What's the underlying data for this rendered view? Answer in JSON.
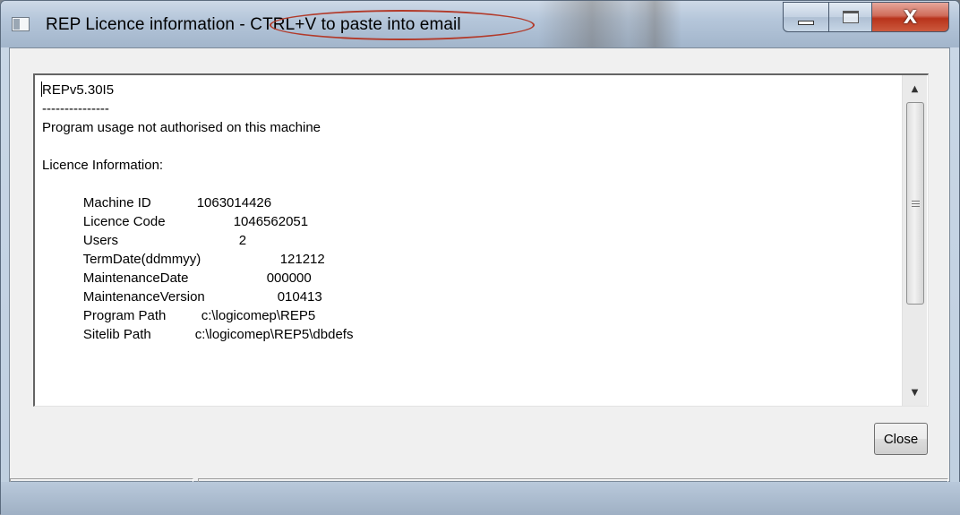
{
  "window": {
    "title": "REP Licence information - CTRL+V to paste into email"
  },
  "caption_buttons": {
    "minimize_icon": "minimize-icon",
    "maximize_icon": "maximize-icon",
    "close_glyph": "X"
  },
  "textbox": {
    "lines": [
      {
        "text": "REPv5.30I5"
      },
      {
        "text": "---------------"
      },
      {
        "text": "Program usage not authorised on this machine"
      },
      {
        "text": ""
      },
      {
        "text": "Licence Information:"
      }
    ],
    "fields": [
      {
        "label": " Machine ID",
        "value": "1063014426"
      },
      {
        "label": " Licence Code",
        "value": "1046562051"
      },
      {
        "label": " Users",
        "value": "2"
      },
      {
        "label": " TermDate(ddmmyy)",
        "value": "121212"
      },
      {
        "label": " MaintenanceDate",
        "value": "000000"
      },
      {
        "label": " MaintenanceVersion",
        "value": "010413"
      },
      {
        "label": " Program Path",
        "value": "c:\\logicomep\\REP5"
      },
      {
        "label": " Sitelib Path",
        "value": "c:\\logicomep\\REP5\\dbdefs"
      }
    ]
  },
  "scrollbar": {
    "up_arrow": "▲",
    "down_arrow": "▼"
  },
  "buttons": {
    "close_label": "Close"
  },
  "statusbar": {
    "pane1": "",
    "pane2": ""
  },
  "colors": {
    "highlight_ellipse": "#b23a2a",
    "close_button_red": "#b8331b"
  }
}
